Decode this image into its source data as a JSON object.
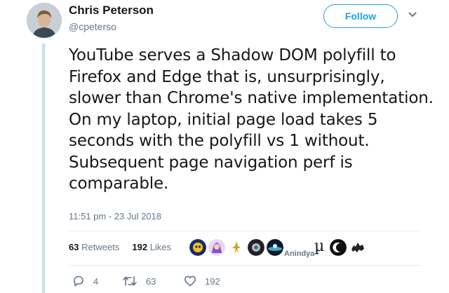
{
  "user": {
    "name": "Chris Peterson",
    "handle": "@cpeterso"
  },
  "follow_label": "Follow",
  "tweet_text": "YouTube serves a Shadow DOM polyfill to Firefox and Edge that is, unsurprisingly, slower than Chrome's native implementation. On my laptop, initial page load takes 5 seconds with the polyfill vs 1 without. Subsequent page navigation perf is comparable.",
  "timestamp": "11:51 pm - 23 Jul 2018",
  "stats": {
    "retweets_count": "63",
    "retweets_label": "Retweets",
    "likes_count": "192",
    "likes_label": "Likes"
  },
  "liker_alt_text": "Anindya",
  "liker_mu": "µ",
  "actions": {
    "reply_count": "4",
    "retweet_count": "63",
    "like_count": "192"
  },
  "colors": {
    "accent": "#1da1f2",
    "thread_line": "#c4e0ec",
    "muted": "#657786"
  }
}
